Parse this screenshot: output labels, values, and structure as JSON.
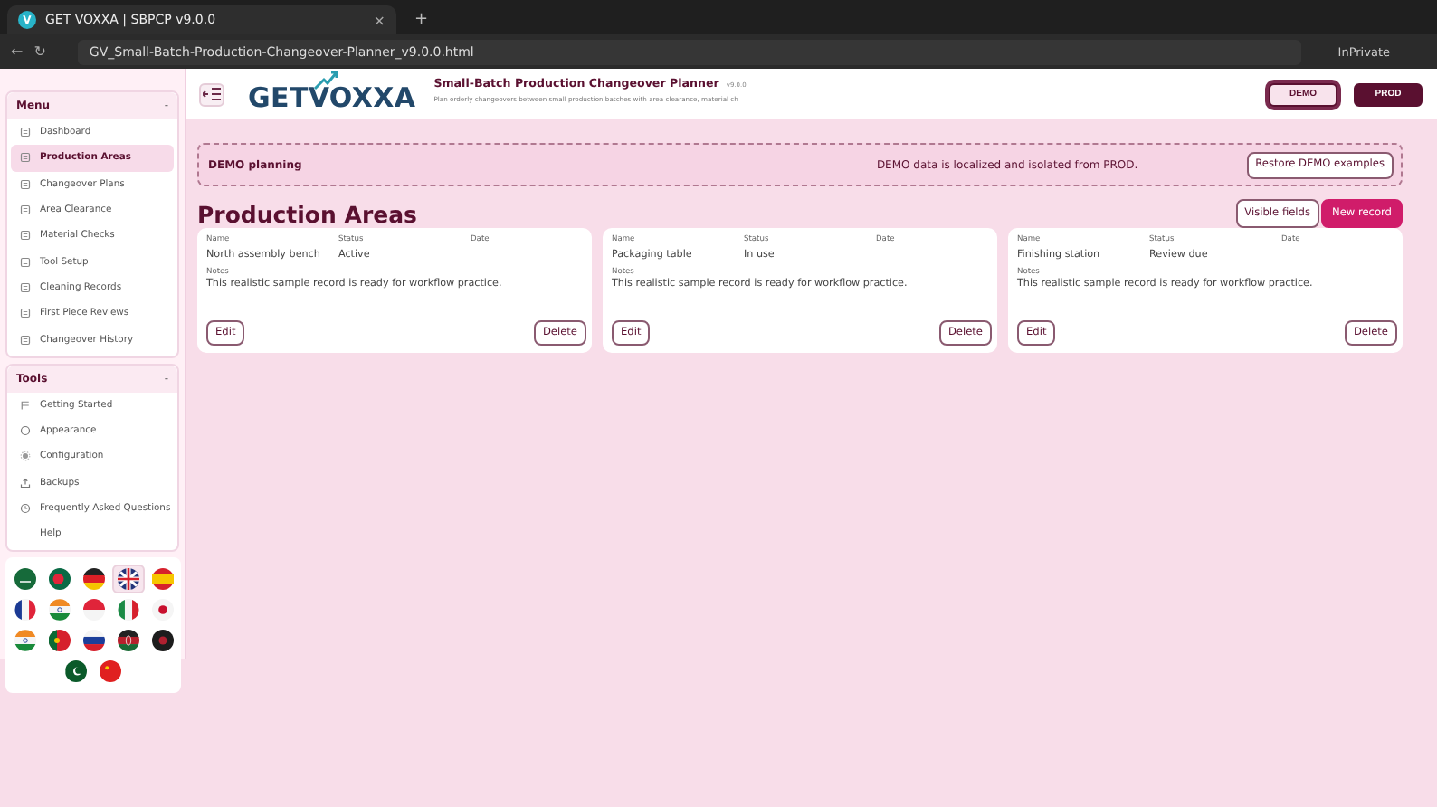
{
  "browser": {
    "tab_title": "GET VOXXA | SBPCP v9.0.0",
    "tab_icon": "V",
    "tab_close": "×",
    "new_tab": "+",
    "back": "←",
    "reload": "↻",
    "address": "GV_Small-Batch-Production-Changeover-Planner_v9.0.0.html",
    "private_label": "InPrivate"
  },
  "sidebar": {
    "sections": [
      {
        "title": "Menu",
        "toggle": "-",
        "items": [
          {
            "label": "Dashboard",
            "selected": false
          },
          {
            "label": "Production Areas",
            "selected": true
          },
          {
            "label": "Changeover Plans",
            "selected": false
          },
          {
            "label": "Area Clearance",
            "selected": false
          },
          {
            "label": "Material Checks",
            "selected": false
          },
          {
            "label": "Tool Setup",
            "selected": false
          },
          {
            "label": "Cleaning Records",
            "selected": false
          },
          {
            "label": "First Piece Reviews",
            "selected": false
          },
          {
            "label": "Changeover History",
            "selected": false
          }
        ]
      },
      {
        "title": "Tools",
        "toggle": "-",
        "items": [
          {
            "label": "Getting Started",
            "selected": false
          },
          {
            "label": "Appearance",
            "selected": false
          },
          {
            "label": "Configuration",
            "selected": false
          },
          {
            "label": "Backups",
            "selected": false
          },
          {
            "label": "Frequently Asked Questions",
            "selected": false
          },
          {
            "label": "Help",
            "selected": false
          }
        ]
      }
    ],
    "languages": [
      {
        "selected": false
      },
      {
        "selected": false
      },
      {
        "selected": false
      },
      {
        "selected": true
      },
      {
        "selected": false
      },
      {
        "selected": false
      },
      {
        "selected": false
      },
      {
        "selected": false
      },
      {
        "selected": false
      },
      {
        "selected": false
      },
      {
        "selected": false
      },
      {
        "selected": false
      },
      {
        "selected": false
      },
      {
        "selected": false
      },
      {
        "selected": false
      },
      {
        "selected": false
      },
      {
        "selected": false
      }
    ]
  },
  "header": {
    "logo_text": "GETVOXXA",
    "title": "Small-Batch Production Changeover Planner",
    "version": "v9.0.0",
    "subtitle": "Plan orderly changeovers between small production batches with area clearance, material ch",
    "modes": [
      {
        "label": "DEMO",
        "selected": true
      },
      {
        "label": "PROD",
        "selected": false
      }
    ]
  },
  "banner": {
    "title": "DEMO planning",
    "message": "DEMO data is localized and isolated from PROD.",
    "button": "Restore DEMO examples"
  },
  "page": {
    "title": "Production Areas",
    "buttons": [
      {
        "label": "Visible fields",
        "kind": "secondary"
      },
      {
        "label": "New record",
        "kind": "primary"
      }
    ]
  },
  "records": [
    {
      "fields": [
        {
          "label": "Name",
          "value": "North assembly bench"
        },
        {
          "label": "Status",
          "value": "Active"
        },
        {
          "label": "Date"
        }
      ],
      "notes_label": "Notes",
      "notes": "This realistic sample record is ready for workflow practice.",
      "actions": [
        "Edit",
        "Delete"
      ]
    },
    {
      "fields": [
        {
          "label": "Name",
          "value": "Packaging table"
        },
        {
          "label": "Status",
          "value": "In use"
        },
        {
          "label": "Date"
        }
      ],
      "notes_label": "Notes",
      "notes": "This realistic sample record is ready for workflow practice.",
      "actions": [
        "Edit",
        "Delete"
      ]
    },
    {
      "fields": [
        {
          "label": "Name",
          "value": "Finishing station"
        },
        {
          "label": "Status",
          "value": "Review due"
        },
        {
          "label": "Date"
        }
      ],
      "notes_label": "Notes",
      "notes": "This realistic sample record is ready for workflow practice.",
      "actions": [
        "Edit",
        "Delete"
      ]
    }
  ]
}
